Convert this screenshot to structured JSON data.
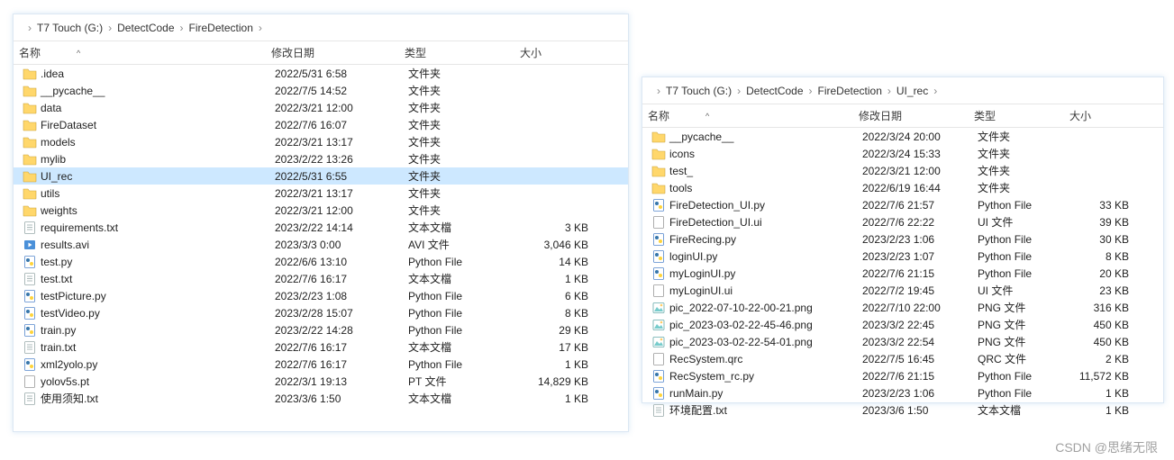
{
  "watermark": "CSDN @思绪无限",
  "panes": [
    {
      "side": "left",
      "breadcrumb": [
        "",
        "T7 Touch (G:)",
        "DetectCode",
        "FireDetection"
      ],
      "columns": {
        "name": "名称",
        "date": "修改日期",
        "type": "类型",
        "size": "大小"
      },
      "sort_caret": "^",
      "rows": [
        {
          "icon": "folder",
          "name": ".idea",
          "date": "2022/5/31 6:58",
          "type": "文件夹",
          "size": ""
        },
        {
          "icon": "folder",
          "name": "__pycache__",
          "date": "2022/7/5 14:52",
          "type": "文件夹",
          "size": ""
        },
        {
          "icon": "folder",
          "name": "data",
          "date": "2022/3/21 12:00",
          "type": "文件夹",
          "size": ""
        },
        {
          "icon": "folder",
          "name": "FireDataset",
          "date": "2022/7/6 16:07",
          "type": "文件夹",
          "size": ""
        },
        {
          "icon": "folder",
          "name": "models",
          "date": "2022/3/21 13:17",
          "type": "文件夹",
          "size": ""
        },
        {
          "icon": "folder",
          "name": "mylib",
          "date": "2023/2/22 13:26",
          "type": "文件夹",
          "size": ""
        },
        {
          "icon": "folder",
          "name": "UI_rec",
          "date": "2022/5/31 6:55",
          "type": "文件夹",
          "size": "",
          "selected": true
        },
        {
          "icon": "folder",
          "name": "utils",
          "date": "2022/3/21 13:17",
          "type": "文件夹",
          "size": ""
        },
        {
          "icon": "folder",
          "name": "weights",
          "date": "2022/3/21 12:00",
          "type": "文件夹",
          "size": ""
        },
        {
          "icon": "txt",
          "name": "requirements.txt",
          "date": "2023/2/22 14:14",
          "type": "文本文檔",
          "size": "3 KB"
        },
        {
          "icon": "avi",
          "name": "results.avi",
          "date": "2023/3/3 0:00",
          "type": "AVI 文件",
          "size": "3,046 KB"
        },
        {
          "icon": "py",
          "name": "test.py",
          "date": "2022/6/6 13:10",
          "type": "Python File",
          "size": "14 KB"
        },
        {
          "icon": "txt",
          "name": "test.txt",
          "date": "2022/7/6 16:17",
          "type": "文本文檔",
          "size": "1 KB"
        },
        {
          "icon": "py",
          "name": "testPicture.py",
          "date": "2023/2/23 1:08",
          "type": "Python File",
          "size": "6 KB"
        },
        {
          "icon": "py",
          "name": "testVideo.py",
          "date": "2023/2/28 15:07",
          "type": "Python File",
          "size": "8 KB"
        },
        {
          "icon": "py",
          "name": "train.py",
          "date": "2023/2/22 14:28",
          "type": "Python File",
          "size": "29 KB"
        },
        {
          "icon": "txt",
          "name": "train.txt",
          "date": "2022/7/6 16:17",
          "type": "文本文檔",
          "size": "17 KB"
        },
        {
          "icon": "py",
          "name": "xml2yolo.py",
          "date": "2022/7/6 16:17",
          "type": "Python File",
          "size": "1 KB"
        },
        {
          "icon": "pt",
          "name": "yolov5s.pt",
          "date": "2022/3/1 19:13",
          "type": "PT 文件",
          "size": "14,829 KB"
        },
        {
          "icon": "txt",
          "name": "使用须知.txt",
          "date": "2023/3/6 1:50",
          "type": "文本文檔",
          "size": "1 KB"
        }
      ]
    },
    {
      "side": "right",
      "breadcrumb": [
        "",
        "T7 Touch (G:)",
        "DetectCode",
        "FireDetection",
        "UI_rec"
      ],
      "columns": {
        "name": "名称",
        "date": "修改日期",
        "type": "类型",
        "size": "大小"
      },
      "sort_caret": "^",
      "rows": [
        {
          "icon": "folder",
          "name": "__pycache__",
          "date": "2022/3/24 20:00",
          "type": "文件夹",
          "size": ""
        },
        {
          "icon": "folder",
          "name": "icons",
          "date": "2022/3/24 15:33",
          "type": "文件夹",
          "size": ""
        },
        {
          "icon": "folder",
          "name": "test_",
          "date": "2022/3/21 12:00",
          "type": "文件夹",
          "size": ""
        },
        {
          "icon": "folder",
          "name": "tools",
          "date": "2022/6/19 16:44",
          "type": "文件夹",
          "size": ""
        },
        {
          "icon": "py",
          "name": "FireDetection_UI.py",
          "date": "2022/7/6 21:57",
          "type": "Python File",
          "size": "33 KB"
        },
        {
          "icon": "ui",
          "name": "FireDetection_UI.ui",
          "date": "2022/7/6 22:22",
          "type": "UI 文件",
          "size": "39 KB"
        },
        {
          "icon": "py",
          "name": "FireRecing.py",
          "date": "2023/2/23 1:06",
          "type": "Python File",
          "size": "30 KB"
        },
        {
          "icon": "py",
          "name": "loginUI.py",
          "date": "2023/2/23 1:07",
          "type": "Python File",
          "size": "8 KB"
        },
        {
          "icon": "py",
          "name": "myLoginUI.py",
          "date": "2022/7/6 21:15",
          "type": "Python File",
          "size": "20 KB"
        },
        {
          "icon": "ui",
          "name": "myLoginUI.ui",
          "date": "2022/7/2 19:45",
          "type": "UI 文件",
          "size": "23 KB"
        },
        {
          "icon": "png",
          "name": "pic_2022-07-10-22-00-21.png",
          "date": "2022/7/10 22:00",
          "type": "PNG 文件",
          "size": "316 KB"
        },
        {
          "icon": "png",
          "name": "pic_2023-03-02-22-45-46.png",
          "date": "2023/3/2 22:45",
          "type": "PNG 文件",
          "size": "450 KB"
        },
        {
          "icon": "png",
          "name": "pic_2023-03-02-22-54-01.png",
          "date": "2023/3/2 22:54",
          "type": "PNG 文件",
          "size": "450 KB"
        },
        {
          "icon": "qrc",
          "name": "RecSystem.qrc",
          "date": "2022/7/5 16:45",
          "type": "QRC 文件",
          "size": "2 KB"
        },
        {
          "icon": "py",
          "name": "RecSystem_rc.py",
          "date": "2022/7/6 21:15",
          "type": "Python File",
          "size": "11,572 KB"
        },
        {
          "icon": "py",
          "name": "runMain.py",
          "date": "2023/2/23 1:06",
          "type": "Python File",
          "size": "1 KB"
        },
        {
          "icon": "txt",
          "name": "环境配置.txt",
          "date": "2023/3/6 1:50",
          "type": "文本文檔",
          "size": "1 KB"
        }
      ]
    }
  ]
}
